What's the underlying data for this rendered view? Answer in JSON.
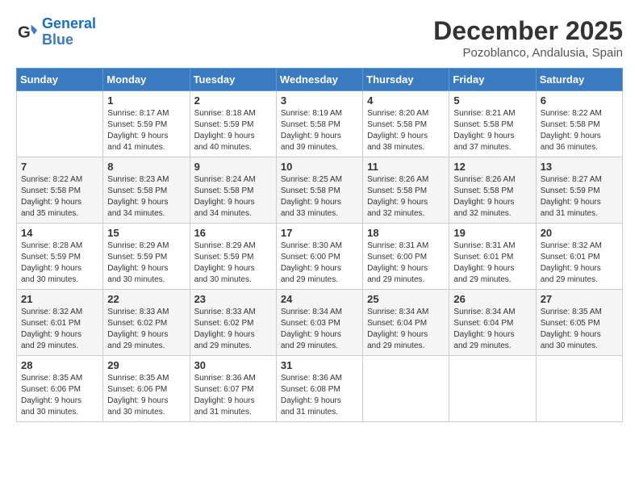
{
  "logo": {
    "line1": "General",
    "line2": "Blue"
  },
  "title": "December 2025",
  "subtitle": "Pozoblanco, Andalusia, Spain",
  "header": {
    "accent_color": "#3a7abf"
  },
  "weekdays": [
    "Sunday",
    "Monday",
    "Tuesday",
    "Wednesday",
    "Thursday",
    "Friday",
    "Saturday"
  ],
  "weeks": [
    [
      {
        "day": "",
        "info": ""
      },
      {
        "day": "1",
        "info": "Sunrise: 8:17 AM\nSunset: 5:59 PM\nDaylight: 9 hours\nand 41 minutes."
      },
      {
        "day": "2",
        "info": "Sunrise: 8:18 AM\nSunset: 5:59 PM\nDaylight: 9 hours\nand 40 minutes."
      },
      {
        "day": "3",
        "info": "Sunrise: 8:19 AM\nSunset: 5:58 PM\nDaylight: 9 hours\nand 39 minutes."
      },
      {
        "day": "4",
        "info": "Sunrise: 8:20 AM\nSunset: 5:58 PM\nDaylight: 9 hours\nand 38 minutes."
      },
      {
        "day": "5",
        "info": "Sunrise: 8:21 AM\nSunset: 5:58 PM\nDaylight: 9 hours\nand 37 minutes."
      },
      {
        "day": "6",
        "info": "Sunrise: 8:22 AM\nSunset: 5:58 PM\nDaylight: 9 hours\nand 36 minutes."
      }
    ],
    [
      {
        "day": "7",
        "info": "Sunrise: 8:22 AM\nSunset: 5:58 PM\nDaylight: 9 hours\nand 35 minutes."
      },
      {
        "day": "8",
        "info": "Sunrise: 8:23 AM\nSunset: 5:58 PM\nDaylight: 9 hours\nand 34 minutes."
      },
      {
        "day": "9",
        "info": "Sunrise: 8:24 AM\nSunset: 5:58 PM\nDaylight: 9 hours\nand 34 minutes."
      },
      {
        "day": "10",
        "info": "Sunrise: 8:25 AM\nSunset: 5:58 PM\nDaylight: 9 hours\nand 33 minutes."
      },
      {
        "day": "11",
        "info": "Sunrise: 8:26 AM\nSunset: 5:58 PM\nDaylight: 9 hours\nand 32 minutes."
      },
      {
        "day": "12",
        "info": "Sunrise: 8:26 AM\nSunset: 5:58 PM\nDaylight: 9 hours\nand 32 minutes."
      },
      {
        "day": "13",
        "info": "Sunrise: 8:27 AM\nSunset: 5:59 PM\nDaylight: 9 hours\nand 31 minutes."
      }
    ],
    [
      {
        "day": "14",
        "info": "Sunrise: 8:28 AM\nSunset: 5:59 PM\nDaylight: 9 hours\nand 30 minutes."
      },
      {
        "day": "15",
        "info": "Sunrise: 8:29 AM\nSunset: 5:59 PM\nDaylight: 9 hours\nand 30 minutes."
      },
      {
        "day": "16",
        "info": "Sunrise: 8:29 AM\nSunset: 5:59 PM\nDaylight: 9 hours\nand 30 minutes."
      },
      {
        "day": "17",
        "info": "Sunrise: 8:30 AM\nSunset: 6:00 PM\nDaylight: 9 hours\nand 29 minutes."
      },
      {
        "day": "18",
        "info": "Sunrise: 8:31 AM\nSunset: 6:00 PM\nDaylight: 9 hours\nand 29 minutes."
      },
      {
        "day": "19",
        "info": "Sunrise: 8:31 AM\nSunset: 6:01 PM\nDaylight: 9 hours\nand 29 minutes."
      },
      {
        "day": "20",
        "info": "Sunrise: 8:32 AM\nSunset: 6:01 PM\nDaylight: 9 hours\nand 29 minutes."
      }
    ],
    [
      {
        "day": "21",
        "info": "Sunrise: 8:32 AM\nSunset: 6:01 PM\nDaylight: 9 hours\nand 29 minutes."
      },
      {
        "day": "22",
        "info": "Sunrise: 8:33 AM\nSunset: 6:02 PM\nDaylight: 9 hours\nand 29 minutes."
      },
      {
        "day": "23",
        "info": "Sunrise: 8:33 AM\nSunset: 6:02 PM\nDaylight: 9 hours\nand 29 minutes."
      },
      {
        "day": "24",
        "info": "Sunrise: 8:34 AM\nSunset: 6:03 PM\nDaylight: 9 hours\nand 29 minutes."
      },
      {
        "day": "25",
        "info": "Sunrise: 8:34 AM\nSunset: 6:04 PM\nDaylight: 9 hours\nand 29 minutes."
      },
      {
        "day": "26",
        "info": "Sunrise: 8:34 AM\nSunset: 6:04 PM\nDaylight: 9 hours\nand 29 minutes."
      },
      {
        "day": "27",
        "info": "Sunrise: 8:35 AM\nSunset: 6:05 PM\nDaylight: 9 hours\nand 30 minutes."
      }
    ],
    [
      {
        "day": "28",
        "info": "Sunrise: 8:35 AM\nSunset: 6:06 PM\nDaylight: 9 hours\nand 30 minutes."
      },
      {
        "day": "29",
        "info": "Sunrise: 8:35 AM\nSunset: 6:06 PM\nDaylight: 9 hours\nand 30 minutes."
      },
      {
        "day": "30",
        "info": "Sunrise: 8:36 AM\nSunset: 6:07 PM\nDaylight: 9 hours\nand 31 minutes."
      },
      {
        "day": "31",
        "info": "Sunrise: 8:36 AM\nSunset: 6:08 PM\nDaylight: 9 hours\nand 31 minutes."
      },
      {
        "day": "",
        "info": ""
      },
      {
        "day": "",
        "info": ""
      },
      {
        "day": "",
        "info": ""
      }
    ]
  ]
}
